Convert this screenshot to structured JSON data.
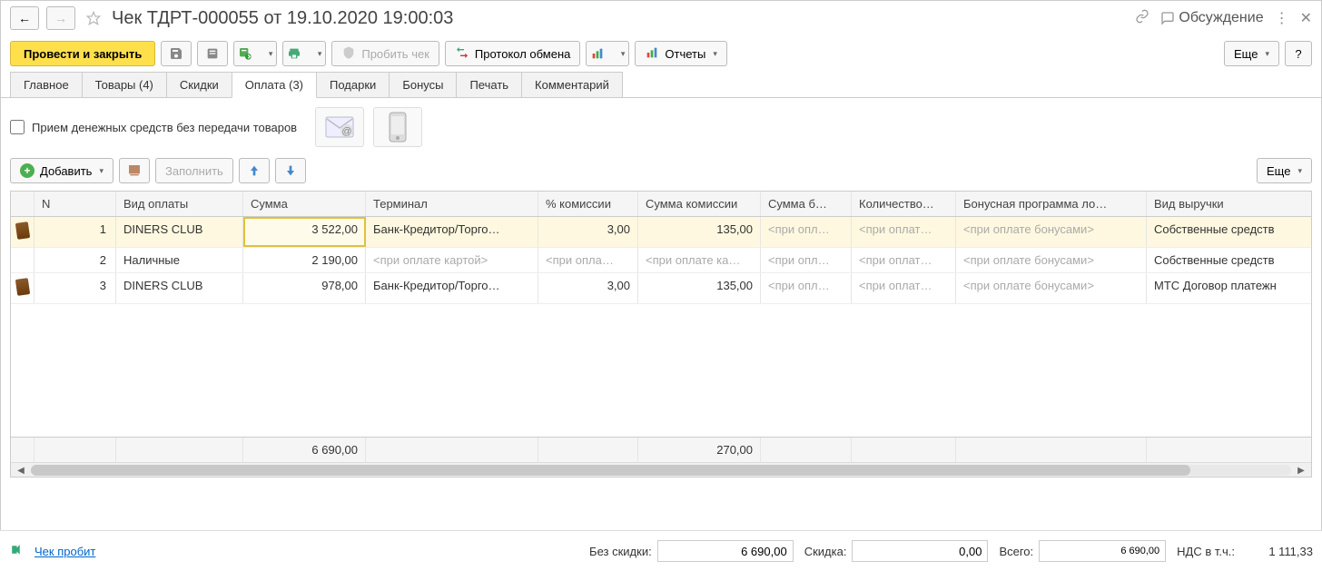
{
  "header": {
    "title": "Чек ТДРТ-000055 от 19.10.2020 19:00:03",
    "discussion": "Обсуждение"
  },
  "toolbar": {
    "post_close": "Провести и закрыть",
    "punch": "Пробить чек",
    "protocol": "Протокол обмена",
    "reports": "Отчеты",
    "more": "Еще",
    "help": "?"
  },
  "tabs": [
    {
      "label": "Главное"
    },
    {
      "label": "Товары (4)"
    },
    {
      "label": "Скидки"
    },
    {
      "label": "Оплата (3)",
      "active": true
    },
    {
      "label": "Подарки"
    },
    {
      "label": "Бонусы"
    },
    {
      "label": "Печать"
    },
    {
      "label": "Комментарий"
    }
  ],
  "checkbox_label": "Прием денежных средств без передачи товаров",
  "subtoolbar": {
    "add": "Добавить",
    "fill": "Заполнить",
    "more": "Еще"
  },
  "columns": {
    "n": "N",
    "type": "Вид оплаты",
    "sum": "Сумма",
    "terminal": "Терминал",
    "comm_pct": "% комиссии",
    "comm_sum": "Сумма комиссии",
    "sum_b": "Сумма б…",
    "qty": "Количество…",
    "bonus": "Бонусная программа ло…",
    "revenue": "Вид выручки"
  },
  "rows": [
    {
      "icon": true,
      "n": "1",
      "type": "DINERS CLUB",
      "sum": "3 522,00",
      "terminal": "Банк-Кредитор/Торго…",
      "comm_pct": "3,00",
      "comm_sum": "135,00",
      "sum_b": "<при опл…",
      "qty": "<при оплат…",
      "bonus": "<при оплате бонусами>",
      "revenue": "Собственные средств",
      "selected": true,
      "focus_col": "sum"
    },
    {
      "icon": false,
      "n": "2",
      "type": "Наличные",
      "sum": "2 190,00",
      "terminal": "<при оплате картой>",
      "comm_pct": "<при опла…",
      "comm_sum": "<при оплате ка…",
      "sum_b": "<при опл…",
      "qty": "<при оплат…",
      "bonus": "<при оплате бонусами>",
      "revenue": "Собственные средств",
      "terminal_ph": true,
      "comm_ph": true
    },
    {
      "icon": true,
      "n": "3",
      "type": "DINERS CLUB",
      "sum": "978,00",
      "terminal": "Банк-Кредитор/Торго…",
      "comm_pct": "3,00",
      "comm_sum": "135,00",
      "sum_b": "<при опл…",
      "qty": "<при оплат…",
      "bonus": "<при оплате бонусами>",
      "revenue": "МТС Договор платежн"
    }
  ],
  "totals": {
    "sum": "6 690,00",
    "comm_sum": "270,00"
  },
  "footer": {
    "link": "Чек пробит",
    "no_discount_label": "Без скидки:",
    "no_discount": "6 690,00",
    "discount_label": "Скидка:",
    "discount": "0,00",
    "total_label": "Всего:",
    "total": "6 690,00",
    "vat_label": "НДС в т.ч.:",
    "vat": "1 111,33"
  }
}
